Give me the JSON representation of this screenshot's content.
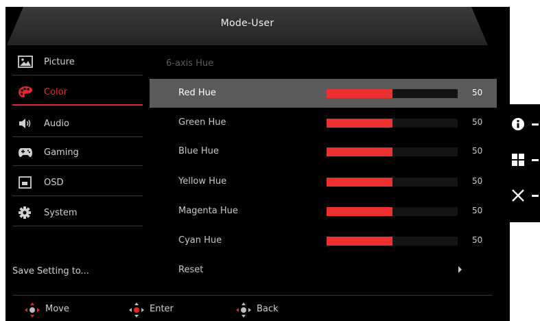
{
  "header": {
    "title": "Mode-User"
  },
  "sidebar": {
    "items": [
      {
        "label": "Picture",
        "icon": "picture-icon"
      },
      {
        "label": "Color",
        "icon": "palette-icon",
        "active": true
      },
      {
        "label": "Audio",
        "icon": "speaker-icon"
      },
      {
        "label": "Gaming",
        "icon": "gamepad-icon"
      },
      {
        "label": "OSD",
        "icon": "osd-window-icon"
      },
      {
        "label": "System",
        "icon": "gear-icon"
      }
    ],
    "save_label": "Save Setting to..."
  },
  "main": {
    "section_title": "6-axis Hue",
    "rows": [
      {
        "label": "Red Hue",
        "value": "50",
        "fraction": 0.5,
        "selected": true
      },
      {
        "label": "Green Hue",
        "value": "50",
        "fraction": 0.5
      },
      {
        "label": "Blue Hue",
        "value": "50",
        "fraction": 0.5
      },
      {
        "label": "Yellow Hue",
        "value": "50",
        "fraction": 0.5
      },
      {
        "label": "Magenta Hue",
        "value": "50",
        "fraction": 0.5
      },
      {
        "label": "Cyan Hue",
        "value": "50",
        "fraction": 0.5
      }
    ],
    "reset_label": "Reset"
  },
  "footer": {
    "move_label": "Move",
    "enter_label": "Enter",
    "back_label": "Back"
  },
  "hotkeys": [
    {
      "icon": "info-icon"
    },
    {
      "icon": "menu-grid-icon"
    },
    {
      "icon": "close-icon"
    }
  ],
  "colors": {
    "accent": "#e4262b",
    "bar_fill": "#ec2f2f",
    "highlight": "#5a5a5a"
  }
}
